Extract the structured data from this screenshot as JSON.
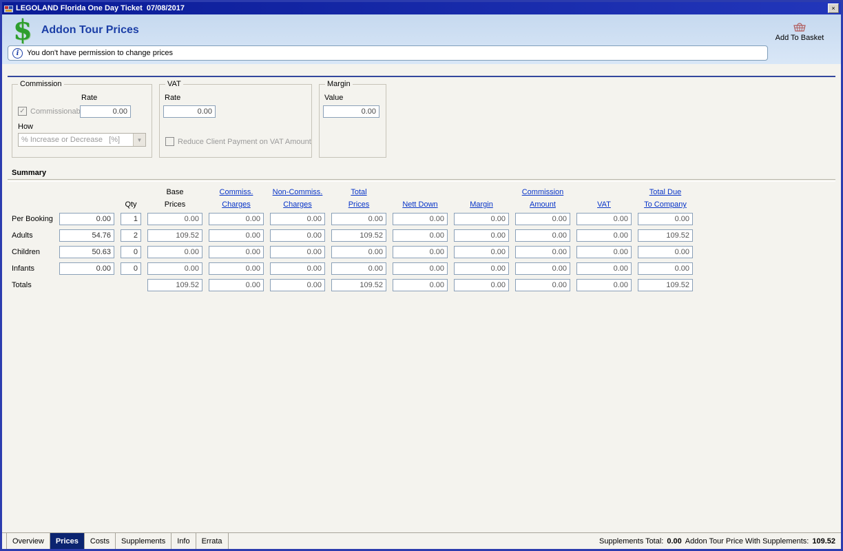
{
  "window": {
    "title": "LEGOLAND Florida One Day Ticket  07/08/2017"
  },
  "icons": {
    "close": "×",
    "dollar": "$",
    "info": "i",
    "dropdown_arrow": "▼",
    "check": "✓"
  },
  "header": {
    "title": "Addon Tour Prices",
    "add_to_basket_label": "Add To Basket",
    "info_message": "You don't have permission to change prices"
  },
  "commission_box": {
    "title": "Commission",
    "rate_label": "Rate",
    "commissionable_label": "Commissionable",
    "rate_value": "0.00",
    "how_label": "How",
    "how_value": "% Increase or Decrease   [%]"
  },
  "vat_box": {
    "title": "VAT",
    "rate_label": "Rate",
    "rate_value": "0.00",
    "reduce_label": "Reduce Client Payment on VAT Amount"
  },
  "margin_box": {
    "title": "Margin",
    "value_label": "Value",
    "value": "0.00"
  },
  "summary": {
    "title": "Summary",
    "headers": {
      "qty": "Qty",
      "base_top": "Base",
      "base_bot": "Prices",
      "commiss_top": "Commiss.",
      "commiss_bot": "Charges",
      "noncommiss_top": "Non-Commiss.",
      "noncommiss_bot": "Charges",
      "total_top": "Total",
      "total_bot": "Prices",
      "nett": "Nett Down",
      "margin": "Margin",
      "commission_top": "Commission",
      "commission_bot": "Amount",
      "vat": "VAT",
      "totaldue_top": "Total Due",
      "totaldue_bot": "To Company"
    },
    "rows": [
      {
        "label": "Per Booking",
        "price": "0.00",
        "qty": "1",
        "values": [
          "0.00",
          "0.00",
          "0.00",
          "0.00",
          "0.00",
          "0.00",
          "0.00",
          "0.00",
          "0.00"
        ]
      },
      {
        "label": "Adults",
        "price": "54.76",
        "qty": "2",
        "values": [
          "109.52",
          "0.00",
          "0.00",
          "109.52",
          "0.00",
          "0.00",
          "0.00",
          "0.00",
          "109.52"
        ]
      },
      {
        "label": "Children",
        "price": "50.63",
        "qty": "0",
        "values": [
          "0.00",
          "0.00",
          "0.00",
          "0.00",
          "0.00",
          "0.00",
          "0.00",
          "0.00",
          "0.00"
        ]
      },
      {
        "label": "Infants",
        "price": "0.00",
        "qty": "0",
        "values": [
          "0.00",
          "0.00",
          "0.00",
          "0.00",
          "0.00",
          "0.00",
          "0.00",
          "0.00",
          "0.00"
        ]
      }
    ],
    "totals": {
      "label": "Totals",
      "values": [
        "109.52",
        "0.00",
        "0.00",
        "109.52",
        "0.00",
        "0.00",
        "0.00",
        "0.00",
        "109.52"
      ]
    }
  },
  "tabs": {
    "items": [
      {
        "label": "Overview"
      },
      {
        "label": "Prices"
      },
      {
        "label": "Costs"
      },
      {
        "label": "Supplements"
      },
      {
        "label": "Info"
      },
      {
        "label": "Errata"
      }
    ]
  },
  "statusbar": {
    "supplements_total_label": "Supplements Total:",
    "supplements_total_value": "0.00",
    "addon_price_label": "Addon Tour Price With Supplements:",
    "addon_price_value": "109.52"
  },
  "colors": {
    "titlebar": "#0a1b96",
    "accent_line": "#33479e",
    "link": "#0633c8",
    "active_tab_bg": "#0b2470",
    "dollar_green": "#2e9e2e"
  }
}
